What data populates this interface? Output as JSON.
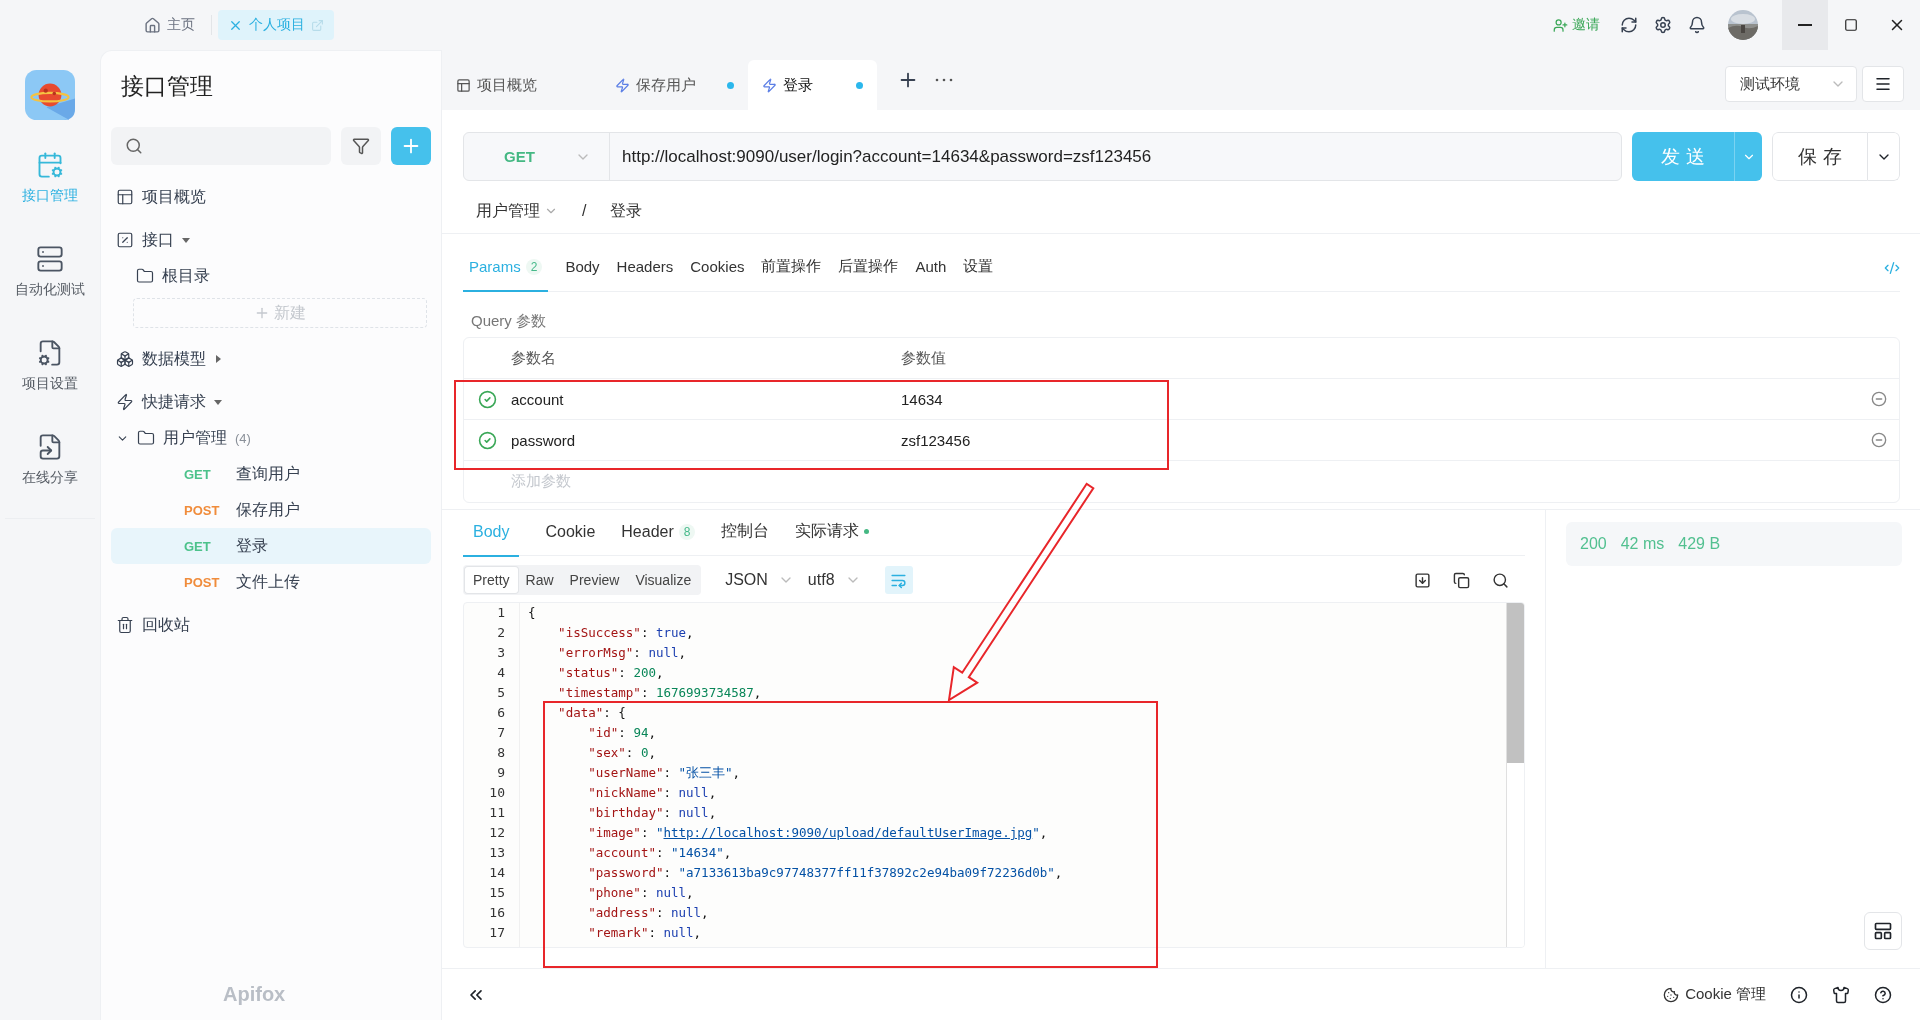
{
  "top_bar": {
    "tabs": [
      {
        "kind": "home",
        "label": "主页",
        "selected": false
      },
      {
        "kind": "project",
        "label": "个人项目",
        "selected": true
      }
    ],
    "invite": "邀请"
  },
  "rail": {
    "items": [
      {
        "kind": "api",
        "label": "接口管理",
        "selected": true
      },
      {
        "kind": "test",
        "label": "自动化测试",
        "selected": false
      },
      {
        "kind": "settings",
        "label": "项目设置",
        "selected": false
      },
      {
        "kind": "share",
        "label": "在线分享",
        "selected": false
      }
    ]
  },
  "sidebar": {
    "title": "接口管理",
    "brand": "Apifox",
    "items": [
      {
        "kind": "overview",
        "label": "项目概览"
      },
      {
        "kind": "api",
        "label": "接口",
        "expanded": true,
        "children": [
          {
            "kind": "folder",
            "label": "根目录"
          },
          {
            "kind": "new",
            "label": "新建"
          }
        ]
      },
      {
        "kind": "model",
        "label": "数据模型",
        "expanded": false
      },
      {
        "kind": "quick",
        "label": "快捷请求",
        "expanded": true,
        "children": [
          {
            "kind": "group",
            "label": "用户管理",
            "count": "(4)",
            "expanded": true,
            "children": [
              {
                "kind": "request",
                "method": "GET",
                "color": "#4cc28b",
                "label": "查询用户",
                "selected": false
              },
              {
                "kind": "request",
                "method": "POST",
                "color": "#f08c3b",
                "label": "保存用户",
                "selected": false
              },
              {
                "kind": "request",
                "method": "GET",
                "color": "#4cc28b",
                "label": "登录",
                "selected": true
              },
              {
                "kind": "request",
                "method": "POST",
                "color": "#f08c3b",
                "label": "文件上传",
                "selected": false
              }
            ]
          }
        ]
      },
      {
        "kind": "trash",
        "label": "回收站"
      }
    ]
  },
  "request_tabs": [
    {
      "kind": "overview",
      "label": "项目概览",
      "selected": false,
      "unsaved": false
    },
    {
      "kind": "quick",
      "label": "保存用户",
      "selected": false,
      "unsaved": true
    },
    {
      "kind": "quick",
      "label": "登录",
      "selected": true,
      "unsaved": true
    }
  ],
  "environment": "测试环境",
  "request": {
    "method": "GET",
    "url": "http://localhost:9090/user/login?account=14634&password=zsf123456",
    "send": "发 送",
    "save": "保 存"
  },
  "breadcrumb": {
    "folder": "用户管理",
    "separator": "/",
    "current": "登录"
  },
  "param_tabs": [
    {
      "label": "Params",
      "badge": "2",
      "selected": true
    },
    {
      "label": "Body",
      "selected": false
    },
    {
      "label": "Headers",
      "selected": false
    },
    {
      "label": "Cookies",
      "selected": false
    },
    {
      "label": "前置操作",
      "selected": false
    },
    {
      "label": "后置操作",
      "selected": false
    },
    {
      "label": "Auth",
      "selected": false
    },
    {
      "label": "设置",
      "selected": false
    }
  ],
  "query": {
    "title": "Query 参数",
    "columns": [
      "参数名",
      "参数值"
    ],
    "rows": [
      {
        "enabled": true,
        "name": "account",
        "value": "14634"
      },
      {
        "enabled": true,
        "name": "password",
        "value": "zsf123456"
      }
    ],
    "add_placeholder": "添加参数"
  },
  "response": {
    "tabs": [
      {
        "label": "Body",
        "selected": true
      },
      {
        "label": "Cookie",
        "selected": false
      },
      {
        "label": "Header",
        "badge": "8",
        "selected": false
      },
      {
        "label": "控制台",
        "selected": false
      },
      {
        "label": "实际请求",
        "dot": true,
        "selected": false
      }
    ],
    "views": [
      {
        "label": "Pretty",
        "selected": true
      },
      {
        "label": "Raw",
        "selected": false
      },
      {
        "label": "Preview",
        "selected": false
      },
      {
        "label": "Visualize",
        "selected": false
      }
    ],
    "format": "JSON",
    "encoding": "utf8",
    "wrap": true,
    "lines": [
      {
        "no": "1",
        "tokens": [
          {
            "kind": "punct",
            "text": "{"
          }
        ]
      },
      {
        "no": "2",
        "tokens": [
          {
            "kind": "key",
            "text": "    \"isSuccess\""
          },
          {
            "kind": "punct",
            "text": ": "
          },
          {
            "kind": "keyword",
            "text": "true"
          },
          {
            "kind": "punct",
            "text": ","
          }
        ]
      },
      {
        "no": "3",
        "tokens": [
          {
            "kind": "key",
            "text": "    \"errorMsg\""
          },
          {
            "kind": "punct",
            "text": ": "
          },
          {
            "kind": "keyword",
            "text": "null"
          },
          {
            "kind": "punct",
            "text": ","
          }
        ]
      },
      {
        "no": "4",
        "tokens": [
          {
            "kind": "key",
            "text": "    \"status\""
          },
          {
            "kind": "punct",
            "text": ": "
          },
          {
            "kind": "number",
            "text": "200"
          },
          {
            "kind": "punct",
            "text": ","
          }
        ]
      },
      {
        "no": "5",
        "tokens": [
          {
            "kind": "key",
            "text": "    \"timestamp\""
          },
          {
            "kind": "punct",
            "text": ": "
          },
          {
            "kind": "number",
            "text": "1676993734587"
          },
          {
            "kind": "punct",
            "text": ","
          }
        ]
      },
      {
        "no": "6",
        "tokens": [
          {
            "kind": "key",
            "text": "    \"data\""
          },
          {
            "kind": "punct",
            "text": ": {"
          }
        ]
      },
      {
        "no": "7",
        "tokens": [
          {
            "kind": "key",
            "text": "        \"id\""
          },
          {
            "kind": "punct",
            "text": ": "
          },
          {
            "kind": "number",
            "text": "94"
          },
          {
            "kind": "punct",
            "text": ","
          }
        ]
      },
      {
        "no": "8",
        "tokens": [
          {
            "kind": "key",
            "text": "        \"sex\""
          },
          {
            "kind": "punct",
            "text": ": "
          },
          {
            "kind": "number",
            "text": "0"
          },
          {
            "kind": "punct",
            "text": ","
          }
        ]
      },
      {
        "no": "9",
        "tokens": [
          {
            "kind": "key",
            "text": "        \"userName\""
          },
          {
            "kind": "punct",
            "text": ": "
          },
          {
            "kind": "string",
            "text": "\"张三丰\""
          },
          {
            "kind": "punct",
            "text": ","
          }
        ]
      },
      {
        "no": "10",
        "tokens": [
          {
            "kind": "key",
            "text": "        \"nickName\""
          },
          {
            "kind": "punct",
            "text": ": "
          },
          {
            "kind": "keyword",
            "text": "null"
          },
          {
            "kind": "punct",
            "text": ","
          }
        ]
      },
      {
        "no": "11",
        "tokens": [
          {
            "kind": "key",
            "text": "        \"birthday\""
          },
          {
            "kind": "punct",
            "text": ": "
          },
          {
            "kind": "keyword",
            "text": "null"
          },
          {
            "kind": "punct",
            "text": ","
          }
        ]
      },
      {
        "no": "12",
        "tokens": [
          {
            "kind": "key",
            "text": "        \"image\""
          },
          {
            "kind": "punct",
            "text": ": "
          },
          {
            "kind": "string",
            "text": "\""
          },
          {
            "kind": "link",
            "text": "http://localhost:9090/upload/defaultUserImage.jpg"
          },
          {
            "kind": "string",
            "text": "\""
          },
          {
            "kind": "punct",
            "text": ","
          }
        ]
      },
      {
        "no": "13",
        "tokens": [
          {
            "kind": "key",
            "text": "        \"account\""
          },
          {
            "kind": "punct",
            "text": ": "
          },
          {
            "kind": "string",
            "text": "\"14634\""
          },
          {
            "kind": "punct",
            "text": ","
          }
        ]
      },
      {
        "no": "14",
        "tokens": [
          {
            "kind": "key",
            "text": "        \"password\""
          },
          {
            "kind": "punct",
            "text": ": "
          },
          {
            "kind": "string",
            "text": "\"a7133613ba9c97748377ff11f37892c2e94ba09f72236d0b\""
          },
          {
            "kind": "punct",
            "text": ","
          }
        ]
      },
      {
        "no": "15",
        "tokens": [
          {
            "kind": "key",
            "text": "        \"phone\""
          },
          {
            "kind": "punct",
            "text": ": "
          },
          {
            "kind": "keyword",
            "text": "null"
          },
          {
            "kind": "punct",
            "text": ","
          }
        ]
      },
      {
        "no": "16",
        "tokens": [
          {
            "kind": "key",
            "text": "        \"address\""
          },
          {
            "kind": "punct",
            "text": ": "
          },
          {
            "kind": "keyword",
            "text": "null"
          },
          {
            "kind": "punct",
            "text": ","
          }
        ]
      },
      {
        "no": "17",
        "tokens": [
          {
            "kind": "key",
            "text": "        \"remark\""
          },
          {
            "kind": "punct",
            "text": ": "
          },
          {
            "kind": "keyword",
            "text": "null"
          },
          {
            "kind": "punct",
            "text": ","
          }
        ]
      }
    ],
    "status": {
      "code": "200",
      "time": "42 ms",
      "size": "429 B"
    }
  },
  "footer": {
    "cookie": "Cookie 管理"
  },
  "annotations": [
    {
      "kind": "frame"
    },
    {
      "kind": "frame"
    },
    {
      "kind": "arrow"
    }
  ]
}
